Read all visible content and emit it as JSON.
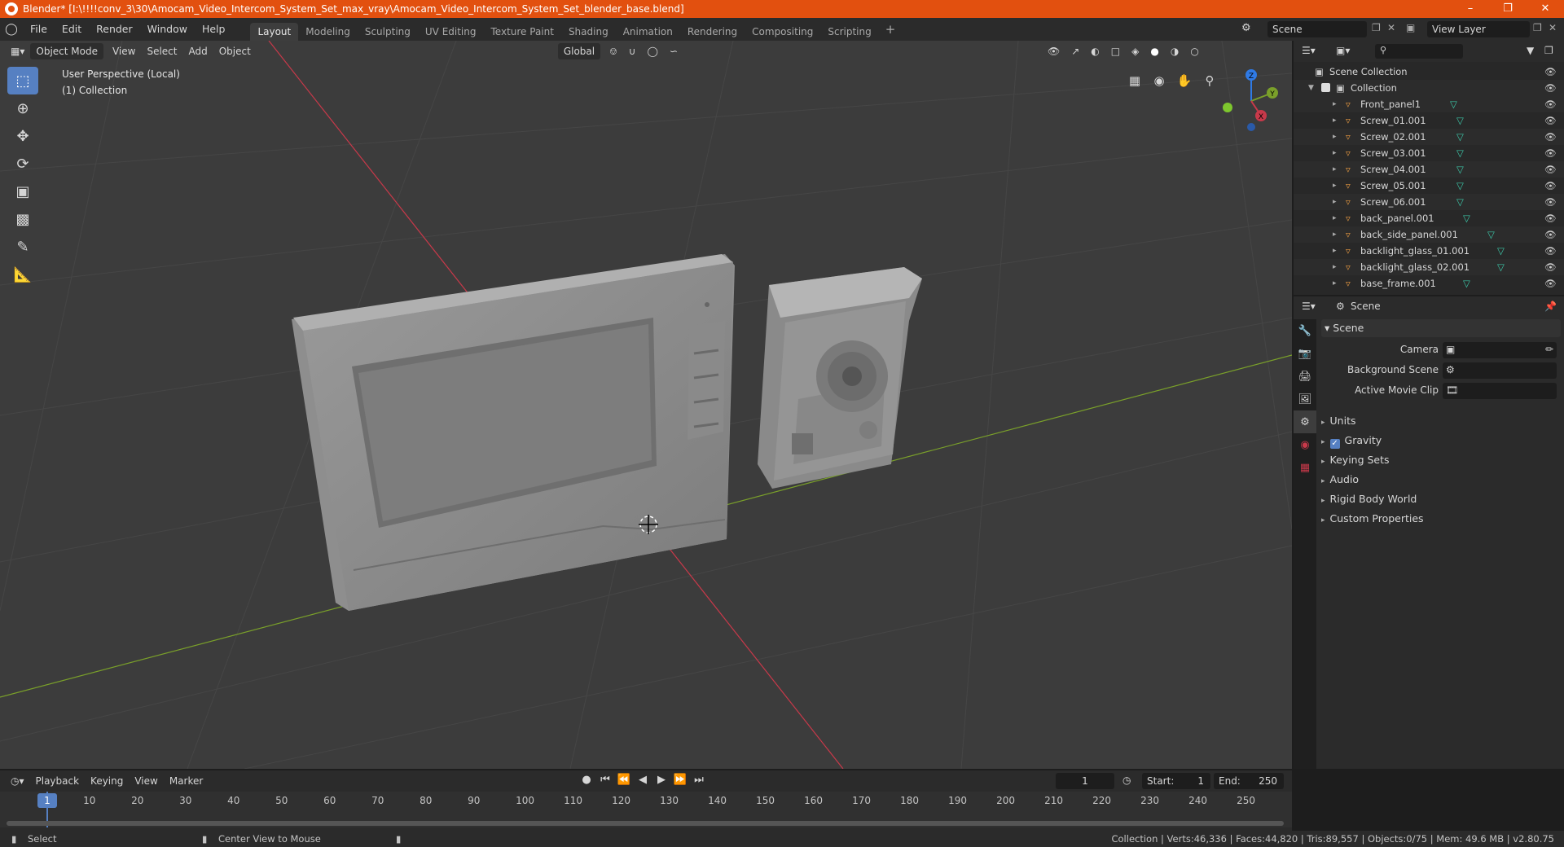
{
  "window": {
    "title": "Blender* [I:\\!!!!conv_3\\30\\Amocam_Video_Intercom_System_Set_max_vray\\Amocam_Video_Intercom_System_Set_blender_base.blend]",
    "controls": [
      "–",
      "❐",
      "✕"
    ]
  },
  "menu": {
    "items": [
      "File",
      "Edit",
      "Render",
      "Window",
      "Help"
    ],
    "workspaces": [
      "Layout",
      "Modeling",
      "Sculpting",
      "UV Editing",
      "Texture Paint",
      "Shading",
      "Animation",
      "Rendering",
      "Compositing",
      "Scripting"
    ],
    "active_workspace": "Layout",
    "add_tab": "+",
    "scene_field": "Scene",
    "view_layer_field": "View Layer"
  },
  "viewport": {
    "mode": "Object Mode",
    "menus": [
      "View",
      "Select",
      "Add",
      "Object"
    ],
    "transform_orientation": "Global",
    "perspective_label": "User Perspective (Local)",
    "collection_label": "(1) Collection",
    "gizmo": {
      "z": "Z",
      "y": "Y",
      "x": "X"
    }
  },
  "outliner": {
    "root": "Scene Collection",
    "collection": "Collection",
    "objects": [
      "Front_panel1",
      "Screw_01.001",
      "Screw_02.001",
      "Screw_03.001",
      "Screw_04.001",
      "Screw_05.001",
      "Screw_06.001",
      "back_panel.001",
      "back_side_panel.001",
      "backlight_glass_01.001",
      "backlight_glass_02.001",
      "base_frame.001"
    ]
  },
  "properties": {
    "context_label": "Scene",
    "panel_title": "Scene",
    "fields": [
      "Camera",
      "Background Scene",
      "Active Movie Clip"
    ],
    "subpanels": [
      "Units",
      "Gravity",
      "Keying Sets",
      "Audio",
      "Rigid Body World",
      "Custom Properties"
    ],
    "gravity_checked": true
  },
  "timeline": {
    "menus": [
      "Playback",
      "Keying",
      "View",
      "Marker"
    ],
    "current_frame": "1",
    "start_label": "Start:",
    "start_value": "1",
    "end_label": "End:",
    "end_value": "250",
    "ruler": [
      "1",
      "10",
      "20",
      "30",
      "40",
      "50",
      "60",
      "70",
      "80",
      "90",
      "100",
      "110",
      "120",
      "130",
      "140",
      "150",
      "160",
      "170",
      "180",
      "190",
      "200",
      "210",
      "220",
      "230",
      "240",
      "250"
    ]
  },
  "statusbar": {
    "select": "Select",
    "center_view": "Center View to Mouse",
    "stats": "Collection | Verts:46,336 | Faces:44,820 | Tris:89,557 | Objects:0/75 | Mem: 49.6 MB | v2.80.75"
  },
  "colors": {
    "title_bar": "#e2500f",
    "viewport_bg": "#3c3c3c",
    "active_blue": "#5680c2",
    "axis_x": "#c8394a",
    "axis_y": "#7aa02a",
    "mesh_icon": "#e09540",
    "data_icon": "#3cc7a8"
  }
}
